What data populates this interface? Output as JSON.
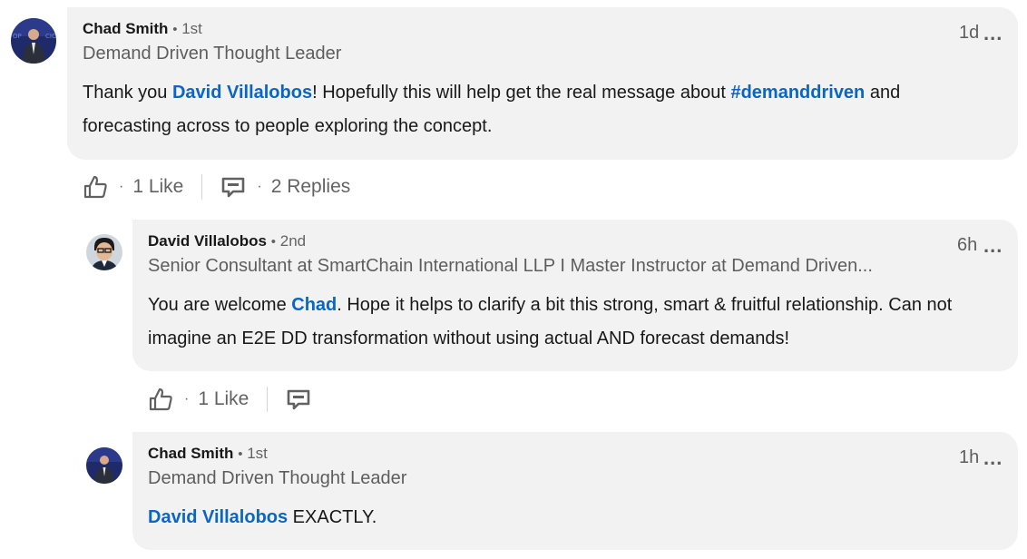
{
  "comments": [
    {
      "author": "Chad Smith",
      "separator": "•",
      "degree": "1st",
      "headline": "Demand Driven Thought Leader",
      "time": "1d",
      "more": "...",
      "text_parts": [
        "Thank you ",
        "David Villalobos",
        "!  Hopefully this will help get the real message about ",
        "#demanddriven",
        " and forecasting across to people exploring the concept."
      ],
      "likes": "1 Like",
      "replies": "2 Replies",
      "sep": "·"
    },
    {
      "author": "David Villalobos",
      "separator": "•",
      "degree": "2nd",
      "headline": "Senior Consultant at SmartChain International LLP I Master Instructor at Demand Driven...",
      "time": "6h",
      "more": "...",
      "text_parts": [
        "You are welcome ",
        "Chad",
        ". Hope it helps to clarify a bit this strong, smart & fruitful relationship. Can not imagine an E2E DD transformation without using actual AND forecast demands!"
      ],
      "likes": "1 Like",
      "sep": "·"
    },
    {
      "author": "Chad Smith",
      "separator": "•",
      "degree": "1st",
      "headline": "Demand Driven Thought Leader",
      "time": "1h",
      "more": "...",
      "text_parts": [
        "David Villalobos",
        " EXACTLY."
      ]
    }
  ],
  "icons": [
    "like-icon",
    "reply-icon"
  ],
  "colors": {
    "link": "#0a66c2",
    "bubble": "#f2f2f2"
  }
}
